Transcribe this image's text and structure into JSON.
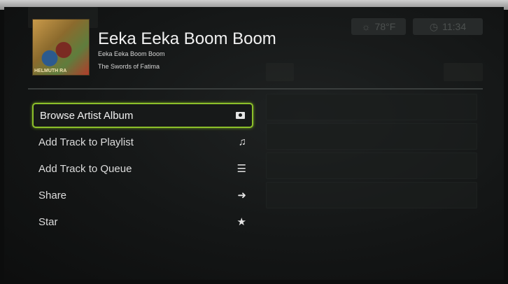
{
  "header": {
    "title": "Eeka Eeka Boom Boom",
    "album": "Eeka Eeka Boom Boom",
    "artist": "The Swords of Fatima",
    "cover_caption": "HELMUTH RA"
  },
  "status": {
    "weather": "78°F",
    "time": "11:34"
  },
  "menu": {
    "items": [
      {
        "label": "Browse Artist Album",
        "icon": "album-icon",
        "selected": true
      },
      {
        "label": "Add Track to Playlist",
        "icon": "music-note-icon"
      },
      {
        "label": "Add Track to Queue",
        "icon": "list-icon"
      },
      {
        "label": "Share",
        "icon": "arrow-right-icon"
      },
      {
        "label": "Star",
        "icon": "star-icon"
      }
    ]
  },
  "colors": {
    "focus": "#8cbf2a",
    "background": "#141616",
    "text": "#e6e6e6"
  }
}
